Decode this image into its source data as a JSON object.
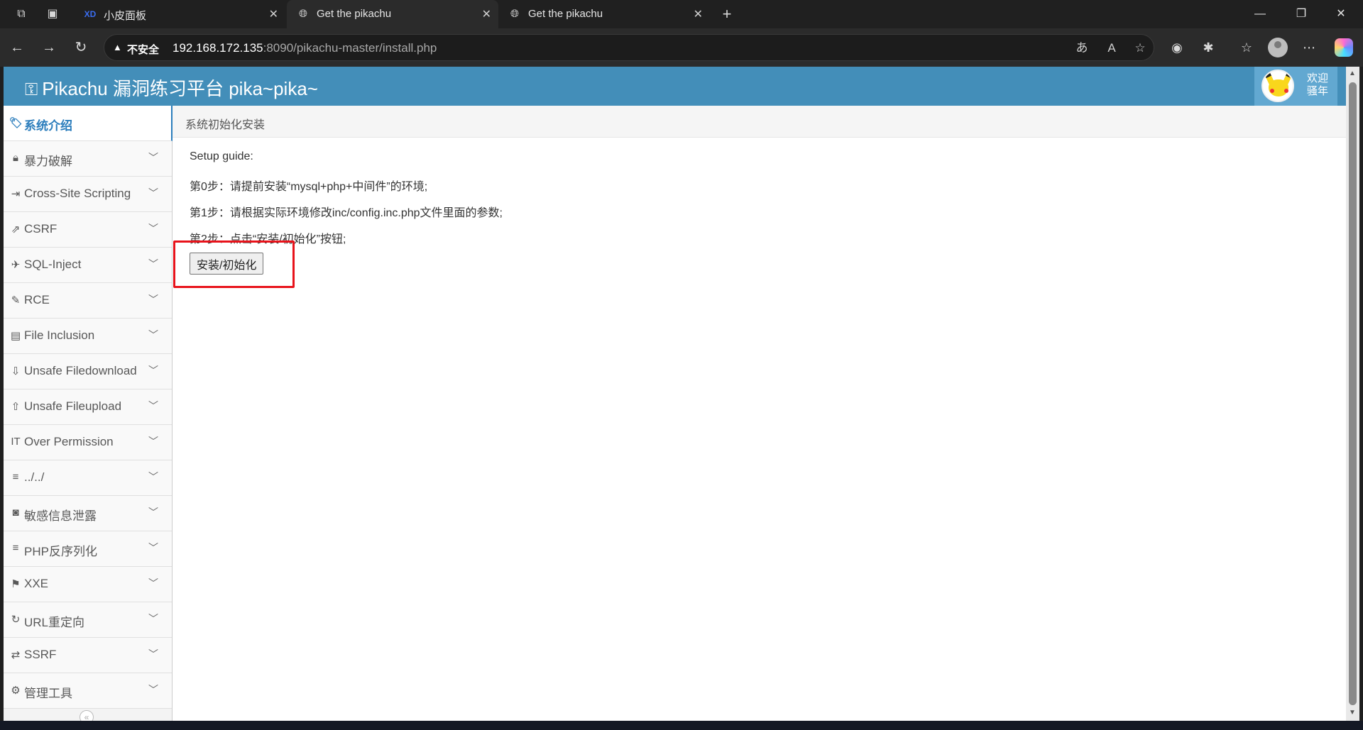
{
  "browser": {
    "tabs": [
      {
        "title": "小皮面板",
        "active": false
      },
      {
        "title": "Get the pikachu",
        "active": true
      },
      {
        "title": "Get the pikachu",
        "active": false
      }
    ],
    "address": {
      "security_label": "不安全",
      "url_host": "192.168.172.135",
      "url_rest": ":8090/pikachu-master/install.php"
    }
  },
  "header": {
    "brand": "Pikachu 漏洞练习平台 pika~pika~",
    "user_line1": "欢迎",
    "user_line2": "骚年"
  },
  "sidebar": {
    "items": [
      {
        "label": "系统介绍",
        "icon": "tags-icon"
      },
      {
        "label": "暴力破解",
        "icon": "lock-icon"
      },
      {
        "label": "Cross-Site Scripting",
        "icon": "indent-icon"
      },
      {
        "label": "CSRF",
        "icon": "share-icon"
      },
      {
        "label": "SQL-Inject",
        "icon": "plane-icon"
      },
      {
        "label": "RCE",
        "icon": "pencil-icon"
      },
      {
        "label": "File Inclusion",
        "icon": "file-icon"
      },
      {
        "label": "Unsafe Filedownload",
        "icon": "download-icon"
      },
      {
        "label": "Unsafe Fileupload",
        "icon": "upload-icon"
      },
      {
        "label": "Over Permission",
        "icon": "text-height-icon"
      },
      {
        "label": "../../",
        "icon": "align-left-icon"
      },
      {
        "label": "敏感信息泄露",
        "icon": "camera-icon"
      },
      {
        "label": "PHP反序列化",
        "icon": "align-left-icon"
      },
      {
        "label": "XXE",
        "icon": "flag-icon"
      },
      {
        "label": "URL重定向",
        "icon": "refresh-icon"
      },
      {
        "label": "SSRF",
        "icon": "exchange-icon"
      },
      {
        "label": "管理工具",
        "icon": "cog-icon"
      }
    ]
  },
  "breadcrumb": "系统初始化安装",
  "content": {
    "guide_title": "Setup guide:",
    "step0": "第0步：请提前安装“mysql+php+中间件”的环境;",
    "step1": "第1步：请根据实际环境修改inc/config.inc.php文件里面的参数;",
    "step2": "第2步：点击“安装/初始化”按钮;",
    "install_button": "安装/初始化"
  },
  "colors": {
    "navbar": "#438eb9",
    "active_link": "#2b7dbc",
    "highlight": "#e8131b"
  }
}
